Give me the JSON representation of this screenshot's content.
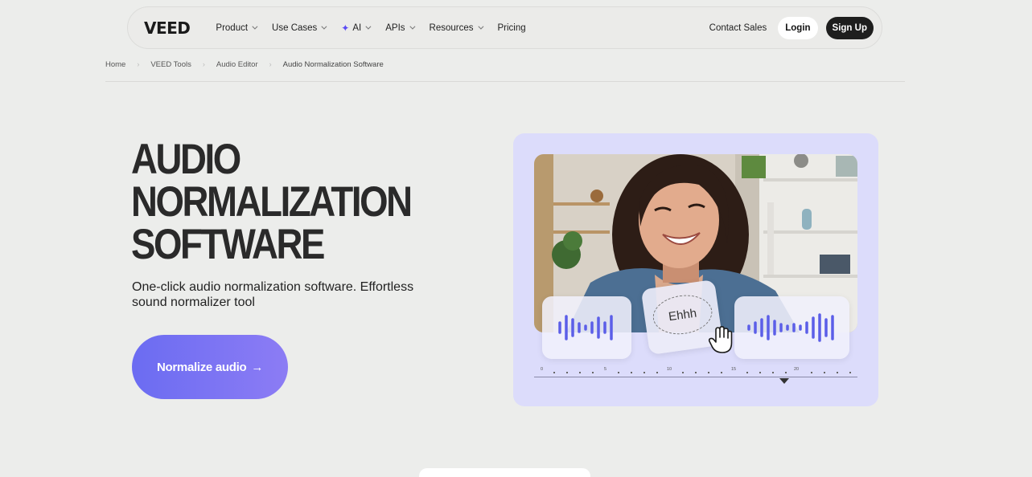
{
  "nav": {
    "logo": "VEED",
    "menu": [
      {
        "label": "Product",
        "has_chevron": true
      },
      {
        "label": "Use Cases",
        "has_chevron": true
      },
      {
        "label": "AI",
        "has_chevron": true,
        "icon": "sparkle-icon"
      },
      {
        "label": "APIs",
        "has_chevron": true
      },
      {
        "label": "Resources",
        "has_chevron": true
      },
      {
        "label": "Pricing",
        "has_chevron": false
      }
    ],
    "contact_sales": "Contact Sales",
    "login": "Login",
    "signup": "Sign Up"
  },
  "breadcrumb": [
    "Home",
    "VEED Tools",
    "Audio Editor",
    "Audio Normalization Software"
  ],
  "hero": {
    "title_lines": [
      "AUDIO",
      "NORMALIZATION",
      "SOFTWARE"
    ],
    "subtitle": "One-click audio normalization software. Effortless sound normalizer tool",
    "cta_label": "Normalize audio",
    "cta_icon": "arrow-right-icon"
  },
  "media": {
    "caption_bubble": "Ehhh",
    "ruler_labels": [
      "0",
      "5",
      "10",
      "15",
      "20"
    ],
    "colors": {
      "card_bg": "#dcdcfb",
      "wave": "#5b5ee8",
      "cta_start": "#6b6cf2",
      "cta_end": "#8c7cf4"
    }
  }
}
